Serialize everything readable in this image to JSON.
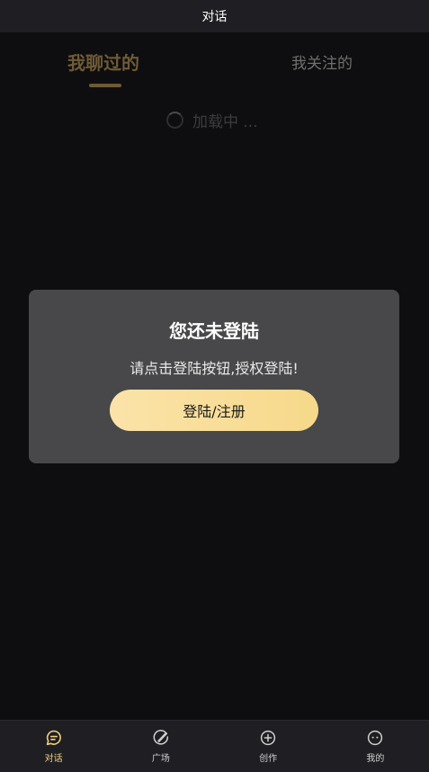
{
  "header": {
    "title": "对话"
  },
  "tabs": [
    {
      "label": "我聊过的",
      "active": true
    },
    {
      "label": "我关注的",
      "active": false
    }
  ],
  "loading": {
    "text": "加载中 ..."
  },
  "modal": {
    "title": "您还未登陆",
    "message": "请点击登陆按钮,授权登陆!",
    "button_label": "登陆/注册"
  },
  "bottom_nav": {
    "items": [
      {
        "label": "对话",
        "icon": "chat-bubble-icon",
        "active": true
      },
      {
        "label": "广场",
        "icon": "plaza-icon",
        "active": false
      },
      {
        "label": "创作",
        "icon": "create-plus-icon",
        "active": false
      },
      {
        "label": "我的",
        "icon": "profile-face-icon",
        "active": false
      }
    ]
  },
  "colors": {
    "accent": "#F3CF7A",
    "active_tab": "#6E5A35",
    "background": "#0E0E10",
    "bar": "#1F1F23",
    "modal": "#48484B",
    "button_start": "#FBE3A9",
    "button_end": "#F6D98A"
  }
}
